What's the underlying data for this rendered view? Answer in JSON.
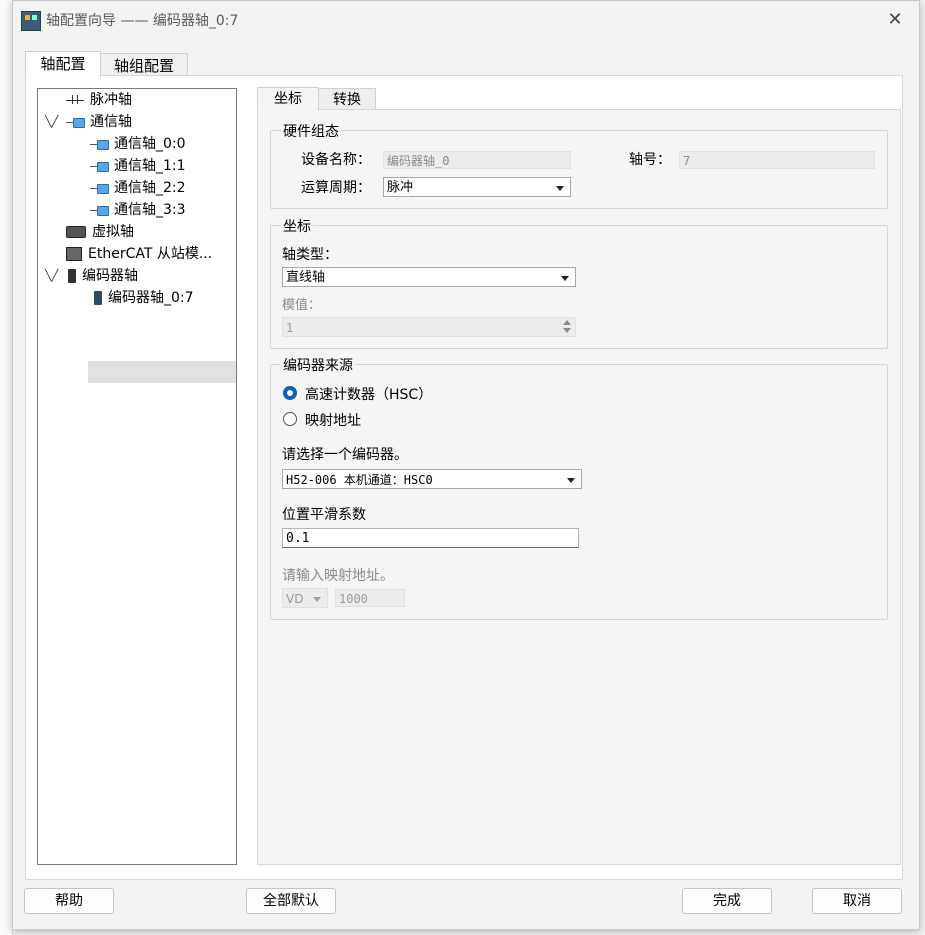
{
  "window": {
    "title": "轴配置向导 —— 编码器轴_0:7"
  },
  "outer_tabs": [
    "轴配置",
    "轴组配置"
  ],
  "tree": {
    "pulse_axis": "脉冲轴",
    "comm_axis": "通信轴",
    "comm_children": [
      "通信轴_0:0",
      "通信轴_1:1",
      "通信轴_2:2",
      "通信轴_3:3"
    ],
    "virtual_axis": "虚拟轴",
    "ethercat": "EtherCAT 从站模...",
    "encoder_axis": "编码器轴",
    "encoder_children": [
      "编码器轴_0:7"
    ]
  },
  "inner_tabs": [
    "坐标",
    "转换"
  ],
  "hardware": {
    "title": "硬件组态",
    "device_name_label": "设备名称：",
    "device_name": "编码器轴_0",
    "axis_no_label": "轴号：",
    "axis_no": "7",
    "cycle_label": "运算周期：",
    "cycle": "脉冲"
  },
  "coordinate": {
    "title": "坐标",
    "axis_type_label": "轴类型：",
    "axis_type": "直线轴",
    "modulo_label": "模值：",
    "modulo": "1"
  },
  "encoder_source": {
    "title": "编码器来源",
    "option_hsc": "高速计数器（HSC）",
    "option_map": "映射地址",
    "selected": "hsc",
    "select_encoder_label": "请选择一个编码器。",
    "encoder": "H52-006 本机通道：HSC0",
    "smoothing_label": "位置平滑系数",
    "smoothing": "0.1",
    "map_addr_label": "请输入映射地址。",
    "map_area": "VD",
    "map_offset": "1000"
  },
  "buttons": {
    "help": "帮助",
    "defaults": "全部默认",
    "finish": "完成",
    "cancel": "取消"
  }
}
